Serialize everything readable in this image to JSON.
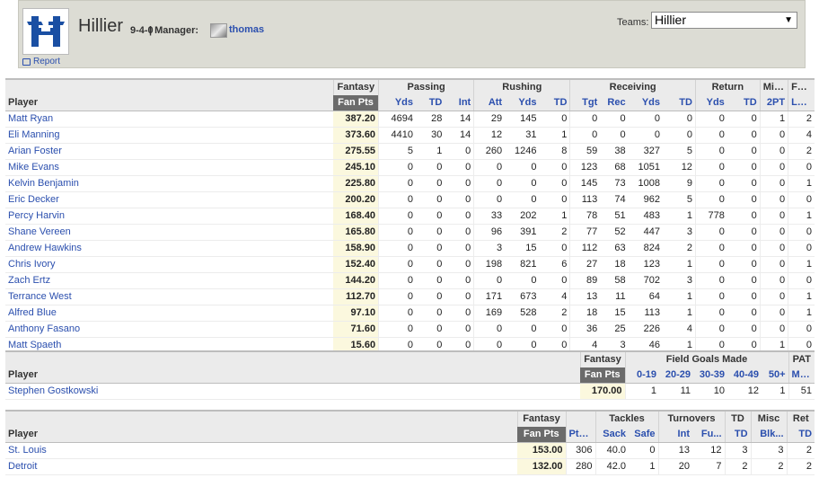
{
  "header": {
    "team_name": "Hillier",
    "record": "9-4-0",
    "manager_label": "| Manager:",
    "manager_name": "thomas",
    "report_label": "Report",
    "teams_label": "Teams:",
    "teams_selected": "Hillier",
    "logo_colors": {
      "primary": "#1a4fa3",
      "accent": "#ffffff"
    }
  },
  "offense": {
    "groups": [
      {
        "label": "",
        "span": 1
      },
      {
        "label": "Fantasy",
        "span": 1
      },
      {
        "label": "Passing",
        "span": 3
      },
      {
        "label": "Rushing",
        "span": 3
      },
      {
        "label": "Receiving",
        "span": 4
      },
      {
        "label": "Return",
        "span": 2
      },
      {
        "label": "Misc",
        "span": 1
      },
      {
        "label": "Fum",
        "span": 1
      }
    ],
    "columns": [
      "Player",
      "Fan Pts",
      "Yds",
      "TD",
      "Int",
      "Att",
      "Yds",
      "TD",
      "Tgt",
      "Rec",
      "Yds",
      "TD",
      "Yds",
      "TD",
      "2PT",
      "Lost"
    ],
    "rows": [
      [
        "Matt Ryan",
        "387.20",
        "4694",
        "28",
        "14",
        "29",
        "145",
        "0",
        "0",
        "0",
        "0",
        "0",
        "0",
        "0",
        "1",
        "2"
      ],
      [
        "Eli Manning",
        "373.60",
        "4410",
        "30",
        "14",
        "12",
        "31",
        "1",
        "0",
        "0",
        "0",
        "0",
        "0",
        "0",
        "0",
        "4"
      ],
      [
        "Arian Foster",
        "275.55",
        "5",
        "1",
        "0",
        "260",
        "1246",
        "8",
        "59",
        "38",
        "327",
        "5",
        "0",
        "0",
        "0",
        "2"
      ],
      [
        "Mike Evans",
        "245.10",
        "0",
        "0",
        "0",
        "0",
        "0",
        "0",
        "123",
        "68",
        "1051",
        "12",
        "0",
        "0",
        "0",
        "0"
      ],
      [
        "Kelvin Benjamin",
        "225.80",
        "0",
        "0",
        "0",
        "0",
        "0",
        "0",
        "145",
        "73",
        "1008",
        "9",
        "0",
        "0",
        "0",
        "1"
      ],
      [
        "Eric Decker",
        "200.20",
        "0",
        "0",
        "0",
        "0",
        "0",
        "0",
        "113",
        "74",
        "962",
        "5",
        "0",
        "0",
        "0",
        "0"
      ],
      [
        "Percy Harvin",
        "168.40",
        "0",
        "0",
        "0",
        "33",
        "202",
        "1",
        "78",
        "51",
        "483",
        "1",
        "778",
        "0",
        "0",
        "1"
      ],
      [
        "Shane Vereen",
        "165.80",
        "0",
        "0",
        "0",
        "96",
        "391",
        "2",
        "77",
        "52",
        "447",
        "3",
        "0",
        "0",
        "0",
        "0"
      ],
      [
        "Andrew Hawkins",
        "158.90",
        "0",
        "0",
        "0",
        "3",
        "15",
        "0",
        "112",
        "63",
        "824",
        "2",
        "0",
        "0",
        "0",
        "0"
      ],
      [
        "Chris Ivory",
        "152.40",
        "0",
        "0",
        "0",
        "198",
        "821",
        "6",
        "27",
        "18",
        "123",
        "1",
        "0",
        "0",
        "0",
        "1"
      ],
      [
        "Zach Ertz",
        "144.20",
        "0",
        "0",
        "0",
        "0",
        "0",
        "0",
        "89",
        "58",
        "702",
        "3",
        "0",
        "0",
        "0",
        "0"
      ],
      [
        "Terrance West",
        "112.70",
        "0",
        "0",
        "0",
        "171",
        "673",
        "4",
        "13",
        "11",
        "64",
        "1",
        "0",
        "0",
        "0",
        "1"
      ],
      [
        "Alfred Blue",
        "97.10",
        "0",
        "0",
        "0",
        "169",
        "528",
        "2",
        "18",
        "15",
        "113",
        "1",
        "0",
        "0",
        "0",
        "1"
      ],
      [
        "Anthony Fasano",
        "71.60",
        "0",
        "0",
        "0",
        "0",
        "0",
        "0",
        "36",
        "25",
        "226",
        "4",
        "0",
        "0",
        "0",
        "0"
      ],
      [
        "Matt Spaeth",
        "15.60",
        "0",
        "0",
        "0",
        "0",
        "0",
        "0",
        "4",
        "3",
        "46",
        "1",
        "0",
        "0",
        "1",
        "0"
      ]
    ]
  },
  "kicker": {
    "groups": [
      {
        "label": "",
        "span": 1
      },
      {
        "label": "Fantasy",
        "span": 1
      },
      {
        "label": "Field Goals Made",
        "span": 5
      },
      {
        "label": "PAT",
        "span": 1
      }
    ],
    "columns": [
      "Player",
      "Fan Pts",
      "0-19",
      "20-29",
      "30-39",
      "40-49",
      "50+",
      "Made"
    ],
    "rows": [
      [
        "Stephen Gostkowski",
        "170.00",
        "1",
        "11",
        "10",
        "12",
        "1",
        "51"
      ]
    ]
  },
  "defense": {
    "groups": [
      {
        "label": "",
        "span": 1
      },
      {
        "label": "Fantasy",
        "span": 1
      },
      {
        "label": "",
        "span": 1
      },
      {
        "label": "Tackles",
        "span": 2
      },
      {
        "label": "Turnovers",
        "span": 2
      },
      {
        "label": "TD",
        "span": 1
      },
      {
        "label": "Misc",
        "span": 1
      },
      {
        "label": "Ret",
        "span": 1
      }
    ],
    "columns": [
      "Player",
      "Fan Pts",
      "Pts ...",
      "Sack",
      "Safe",
      "Int",
      "Fu...",
      "TD",
      "Blk...",
      "TD"
    ],
    "rows": [
      [
        "St. Louis",
        "153.00",
        "306",
        "40.0",
        "0",
        "13",
        "12",
        "3",
        "3",
        "2"
      ],
      [
        "Detroit",
        "132.00",
        "280",
        "42.0",
        "1",
        "20",
        "7",
        "2",
        "2",
        "2"
      ]
    ]
  }
}
